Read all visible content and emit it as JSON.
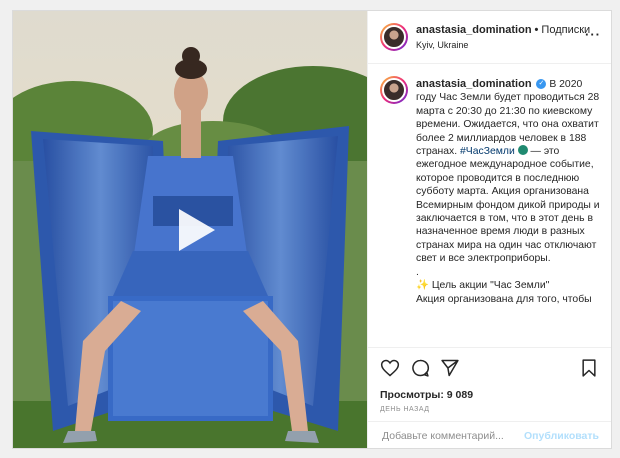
{
  "post": {
    "username": "anastasia_domination",
    "follow_label": "Подписки",
    "location": "Kyiv, Ukraine"
  },
  "caption": {
    "username": "anastasia_domination",
    "text_1": "В 2020 году Час Земли будет проводиться 28 марта с 20:30 до 21:30 по киевскому времени. Ожидается, что она охватит более 2 миллиардов человек в 188 странах.",
    "hashtag": "#ЧасЗемли",
    "text_2": "— это ежегодное международное событие, которое проводится в последнюю субботу марта. Акция организована Всемирным фондом дикой природы и заключается в том, что в этот день в назначенное время люди в разных странах мира на один час отключают свет и все электроприборы.",
    "dot": ".",
    "goal_line": "✨ Цель акции \"Час Земли\"",
    "last_line": "Акция организована для того, чтобы"
  },
  "stats": {
    "views": "Просмотры: 9 089",
    "time_ago": "день назад"
  },
  "comment_box": {
    "placeholder": "Добавьте комментарий...",
    "publish_label": "Опубликовать"
  },
  "icons": {
    "more": "more-options-icon",
    "like": "heart-icon",
    "comment": "comment-icon",
    "share": "share-icon",
    "save": "bookmark-icon",
    "play": "play-icon"
  },
  "colors": {
    "link": "#00376b",
    "verified": "#3897f0",
    "publish_disabled": "#b2dffc",
    "muted": "#8e8e8e"
  }
}
